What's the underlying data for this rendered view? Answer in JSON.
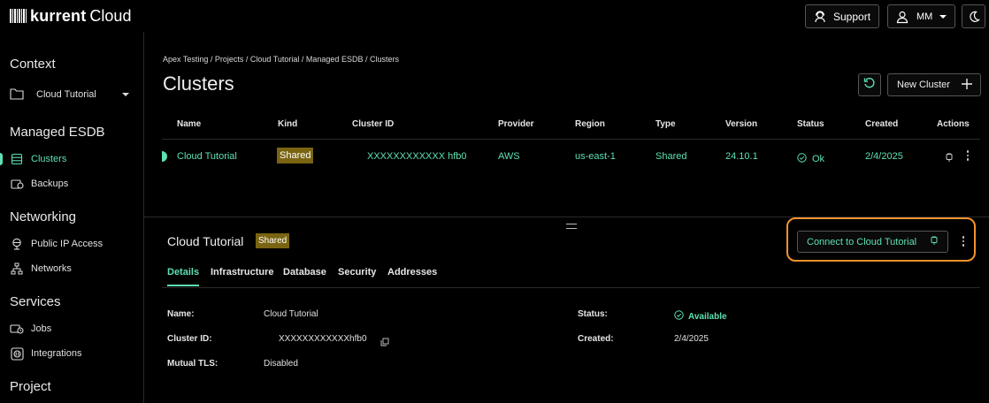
{
  "app": {
    "brand": "kurrent",
    "product": "Cloud"
  },
  "header": {
    "support_label": "Support",
    "user_initials": "MM"
  },
  "sidebar": {
    "context_heading": "Context",
    "context_value": "Cloud Tutorial",
    "sections": [
      {
        "heading": "Managed ESDB",
        "items": [
          {
            "label": "Clusters",
            "icon": "database-icon",
            "active": true
          },
          {
            "label": "Backups",
            "icon": "backup-icon"
          }
        ]
      },
      {
        "heading": "Networking",
        "items": [
          {
            "label": "Public IP Access",
            "icon": "globe-icon"
          },
          {
            "label": "Networks",
            "icon": "network-icon"
          }
        ]
      },
      {
        "heading": "Services",
        "items": [
          {
            "label": "Jobs",
            "icon": "jobs-icon"
          },
          {
            "label": "Integrations",
            "icon": "integrations-icon"
          }
        ]
      },
      {
        "heading": "Project",
        "items": []
      }
    ]
  },
  "main": {
    "breadcrumb": "Apex Testing / Projects / Cloud Tutorial / Managed ESDB / Clusters",
    "title": "Clusters",
    "new_cluster_label": "New Cluster",
    "table": {
      "headers": [
        "Name",
        "Kind",
        "Cluster ID",
        "Provider",
        "Region",
        "Type",
        "Version",
        "Status",
        "Created",
        "Actions"
      ],
      "rows": [
        {
          "name": "Cloud Tutorial",
          "kind": "Shared",
          "cluster_id": "XXXXXXXXXXXX hfb0",
          "provider": "AWS",
          "region": "us-east-1",
          "type": "Shared",
          "version": "24.10.1",
          "status": "Ok",
          "created": "2/4/2025"
        }
      ]
    }
  },
  "details": {
    "title": "Cloud Tutorial",
    "badge": "Shared",
    "connect_label": "Connect to Cloud Tutorial",
    "tabs": [
      "Details",
      "Infrastructure",
      "Database",
      "Security",
      "Addresses"
    ],
    "active_tab": "Details",
    "fields": {
      "name_label": "Name:",
      "name_value": "Cloud Tutorial",
      "cluster_id_label": "Cluster ID:",
      "cluster_id_value": "XXXXXXXXXXXXhfb0",
      "mtls_label": "Mutual TLS:",
      "mtls_value": "Disabled",
      "status_label": "Status:",
      "status_value": "Available",
      "created_label": "Created:",
      "created_value": "2/4/2025"
    }
  },
  "colors": {
    "accent": "#5ee0b0",
    "badge": "#7a6412",
    "highlight": "#f5922b"
  }
}
